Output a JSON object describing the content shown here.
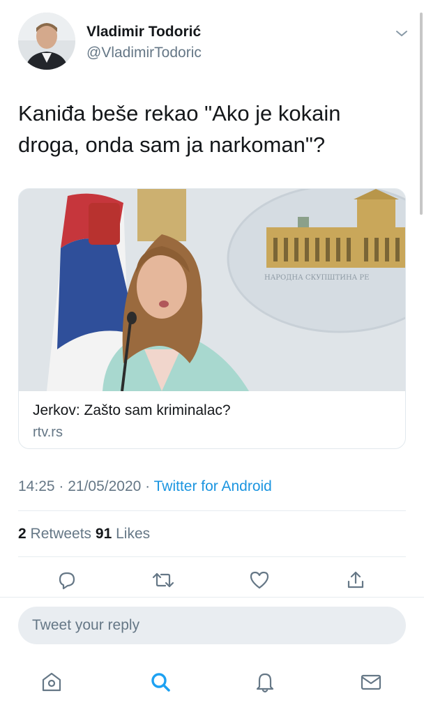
{
  "tweet": {
    "author_name": "Vladimir Todorić",
    "author_handle": "@VladimirTodoric",
    "text": "Kaniđa beše rekao \"Ako je kokain droga, onda sam ja narkoman\"?",
    "card": {
      "title": "Jerkov: Zašto sam kriminalac?",
      "domain": "rtv.rs",
      "image_caption": "НАРОДНА СКУПШТИНА РЕ"
    },
    "time": "14:25 · 21/05/2020 · ",
    "source": "Twitter for Android",
    "retweets_count": "2",
    "retweets_label": " Retweets ",
    "likes_count": "91",
    "likes_label": " Likes"
  },
  "reply": {
    "placeholder": "Tweet your reply"
  },
  "icons": {
    "actions": [
      "reply-icon",
      "retweet-icon",
      "like-icon",
      "share-icon"
    ],
    "tabs": [
      "home-icon",
      "search-icon",
      "notifications-icon",
      "messages-icon"
    ]
  },
  "colors": {
    "accent": "#1da1f2",
    "text": "#14171a",
    "muted": "#657786",
    "source_link": "#1b95e0"
  }
}
